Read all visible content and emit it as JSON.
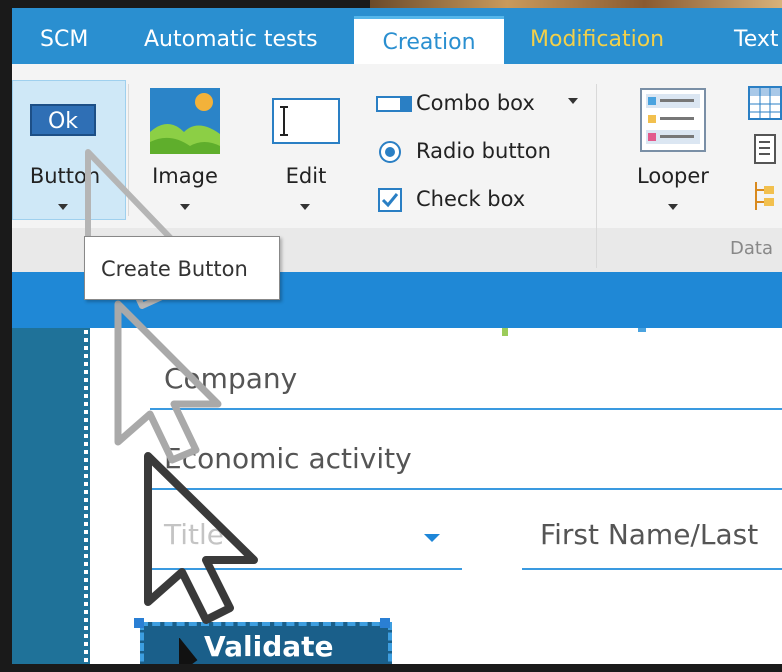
{
  "tabs": [
    {
      "label": "SCM",
      "state": "normal"
    },
    {
      "label": "Automatic tests",
      "state": "normal"
    },
    {
      "label": "Creation",
      "state": "active"
    },
    {
      "label": "Modification",
      "state": "highlight"
    },
    {
      "label": "Text",
      "state": "normal"
    }
  ],
  "ribbon": {
    "ok_label": "Ok",
    "button_label": "Button",
    "image_label": "Image",
    "edit_label": "Edit",
    "combo_box_label": "Combo box",
    "radio_button_label": "Radio button",
    "check_box_label": "Check box",
    "looper_label": "Looper",
    "group_caption_data": "Data"
  },
  "tooltip": {
    "text": "Create Button"
  },
  "form": {
    "company_label": "Company",
    "economic_activity_label": "Economic activity",
    "title_placeholder": "Title",
    "first_last_name_label": "First Name/Last",
    "validate_label": "Validate"
  },
  "colors": {
    "tabbar": "#2a8fd0",
    "active_tab_text": "#2a8fd0",
    "highlight_tab_text": "#f2d04a",
    "blue_band": "#1f88d6",
    "side_panel": "#1f7299",
    "field_line": "#3a9ae0",
    "validate_bg": "#1a5f8a"
  },
  "icons": [
    "image-icon",
    "edit-field-icon",
    "combo-box-icon",
    "radio-button-icon",
    "check-box-icon",
    "looper-icon",
    "table-icon",
    "tree-icon",
    "cursor-arrow"
  ]
}
